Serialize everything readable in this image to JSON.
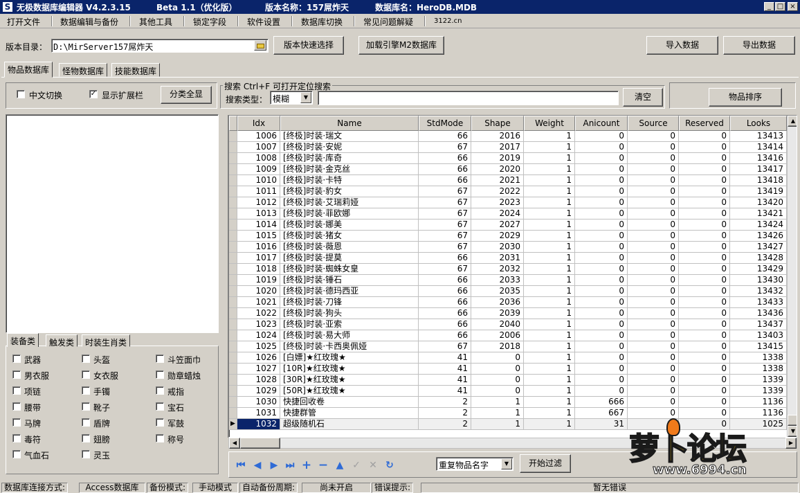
{
  "title": {
    "icon": "S",
    "app": "无极数据库编辑器 V4.2.3.15",
    "beta": "Beta 1.1（优化版）",
    "version_name": "版本名称：157屌炸天",
    "db_name": "数据库名：HeroDB.MDB"
  },
  "window_buttons": {
    "minimize": "_",
    "maximize": "□",
    "close": "×"
  },
  "menu": [
    "打开文件",
    "数据编辑与备份",
    "其他工具",
    "锁定字段",
    "软件设置",
    "数据库切换",
    "常见问题解疑",
    "3122.cn"
  ],
  "toolbar": {
    "dir_label": "版本目录：",
    "dir_value": "D:\\MirServer157屌炸天",
    "quick_select": "版本快速选择",
    "load_m2": "加载引擎M2数据库",
    "import": "导入数据",
    "export": "导出数据"
  },
  "tabs": [
    "物品数据库",
    "怪物数据库",
    "技能数据库"
  ],
  "filters": {
    "chinese_toggle": "中文切换",
    "chinese_checked": false,
    "show_ext": "显示扩展栏",
    "show_ext_checked": true,
    "show_all": "分类全显"
  },
  "search": {
    "group_title": "搜索  Ctrl+F 可打开定位搜索",
    "type_label": "搜索类型：",
    "type_value": "模糊",
    "query": "",
    "clear": "清空",
    "sort": "物品排序"
  },
  "category_tabs": [
    "装备类",
    "触发类",
    "时装生肖类"
  ],
  "categories": [
    {
      "label": "武器",
      "checked": false
    },
    {
      "label": "头盔",
      "checked": false
    },
    {
      "label": "斗笠面巾",
      "checked": false
    },
    {
      "label": "男衣服",
      "checked": false
    },
    {
      "label": "女衣服",
      "checked": false
    },
    {
      "label": "勋章蜡烛",
      "checked": false
    },
    {
      "label": "项链",
      "checked": false
    },
    {
      "label": "手镯",
      "checked": false
    },
    {
      "label": "戒指",
      "checked": false
    },
    {
      "label": "腰带",
      "checked": false
    },
    {
      "label": "靴子",
      "checked": false
    },
    {
      "label": "宝石",
      "checked": false
    },
    {
      "label": "马牌",
      "checked": false
    },
    {
      "label": "盾牌",
      "checked": false
    },
    {
      "label": "军鼓",
      "checked": false
    },
    {
      "label": "毒符",
      "checked": false
    },
    {
      "label": "翅膀",
      "checked": false
    },
    {
      "label": "称号",
      "checked": false
    },
    {
      "label": "气血石",
      "checked": false
    },
    {
      "label": "灵玉",
      "checked": false
    }
  ],
  "grid": {
    "columns": [
      "Idx",
      "Name",
      "StdMode",
      "Shape",
      "Weight",
      "Anicount",
      "Source",
      "Reserved",
      "Looks"
    ],
    "selected_idx": "1032",
    "rows": [
      [
        "1006",
        "[终极]时装·瑞文",
        "66",
        "2016",
        "1",
        "0",
        "0",
        "0",
        "13413"
      ],
      [
        "1007",
        "[终极]时装·安妮",
        "67",
        "2017",
        "1",
        "0",
        "0",
        "0",
        "13414"
      ],
      [
        "1008",
        "[终极]时装·库奇",
        "66",
        "2019",
        "1",
        "0",
        "0",
        "0",
        "13416"
      ],
      [
        "1009",
        "[终极]时装·金克丝",
        "66",
        "2020",
        "1",
        "0",
        "0",
        "0",
        "13417"
      ],
      [
        "1010",
        "[终极]时装·卡特",
        "66",
        "2021",
        "1",
        "0",
        "0",
        "0",
        "13418"
      ],
      [
        "1011",
        "[终极]时装·豹女",
        "67",
        "2022",
        "1",
        "0",
        "0",
        "0",
        "13419"
      ],
      [
        "1012",
        "[终极]时装·艾瑞莉娅",
        "67",
        "2023",
        "1",
        "0",
        "0",
        "0",
        "13420"
      ],
      [
        "1013",
        "[终极]时装·菲欧娜",
        "67",
        "2024",
        "1",
        "0",
        "0",
        "0",
        "13421"
      ],
      [
        "1014",
        "[终极]时装·娜美",
        "67",
        "2027",
        "1",
        "0",
        "0",
        "0",
        "13424"
      ],
      [
        "1015",
        "[终极]时装·猪女",
        "67",
        "2029",
        "1",
        "0",
        "0",
        "0",
        "13426"
      ],
      [
        "1016",
        "[终极]时装·薇恩",
        "67",
        "2030",
        "1",
        "0",
        "0",
        "0",
        "13427"
      ],
      [
        "1017",
        "[终极]时装·提莫",
        "66",
        "2031",
        "1",
        "0",
        "0",
        "0",
        "13428"
      ],
      [
        "1018",
        "[终极]时装·蜘蛛女皇",
        "67",
        "2032",
        "1",
        "0",
        "0",
        "0",
        "13429"
      ],
      [
        "1019",
        "[终极]时装·锤石",
        "66",
        "2033",
        "1",
        "0",
        "0",
        "0",
        "13430"
      ],
      [
        "1020",
        "[终极]时装·德玛西亚",
        "66",
        "2035",
        "1",
        "0",
        "0",
        "0",
        "13432"
      ],
      [
        "1021",
        "[终极]时装·刀锋",
        "66",
        "2036",
        "1",
        "0",
        "0",
        "0",
        "13433"
      ],
      [
        "1022",
        "[终极]时装·狗头",
        "66",
        "2039",
        "1",
        "0",
        "0",
        "0",
        "13436"
      ],
      [
        "1023",
        "[终极]时装·亚索",
        "66",
        "2040",
        "1",
        "0",
        "0",
        "0",
        "13437"
      ],
      [
        "1024",
        "[终极]时装·易大师",
        "66",
        "2006",
        "1",
        "0",
        "0",
        "0",
        "13403"
      ],
      [
        "1025",
        "[终极]时装·卡西奥佩娅",
        "67",
        "2018",
        "1",
        "0",
        "0",
        "0",
        "13415"
      ],
      [
        "1026",
        "[白嫖]★红玫瑰★",
        "41",
        "0",
        "1",
        "0",
        "0",
        "0",
        "1338"
      ],
      [
        "1027",
        "[10R]★红玫瑰★",
        "41",
        "0",
        "1",
        "0",
        "0",
        "0",
        "1338"
      ],
      [
        "1028",
        "[30R]★红玫瑰★",
        "41",
        "0",
        "1",
        "0",
        "0",
        "0",
        "1339"
      ],
      [
        "1029",
        "[50R]★红玫瑰★",
        "41",
        "0",
        "1",
        "0",
        "0",
        "0",
        "1339"
      ],
      [
        "1030",
        "快捷回收卷",
        "2",
        "1",
        "1",
        "666",
        "0",
        "0",
        "1136"
      ],
      [
        "1031",
        "快捷群管",
        "2",
        "1",
        "1",
        "667",
        "0",
        "0",
        "1136"
      ],
      [
        "1032",
        "超级随机石",
        "2",
        "1",
        "1",
        "31",
        "0",
        "0",
        "1025"
      ]
    ]
  },
  "bottom": {
    "dup_select": "重复物品名字",
    "start_filter": "开始过滤"
  },
  "status": {
    "conn_label": "数据库连接方式:",
    "conn_value": "Access数据库",
    "backup_label": "备份模式:",
    "backup_value": "手动模式",
    "auto_label": "自动备份周期:",
    "auto_value": "尚未开启",
    "err_label": "错误提示:",
    "err_value": "暂无错误"
  },
  "watermark": {
    "text": "萝卜论坛",
    "url": "www.6994.cn"
  }
}
